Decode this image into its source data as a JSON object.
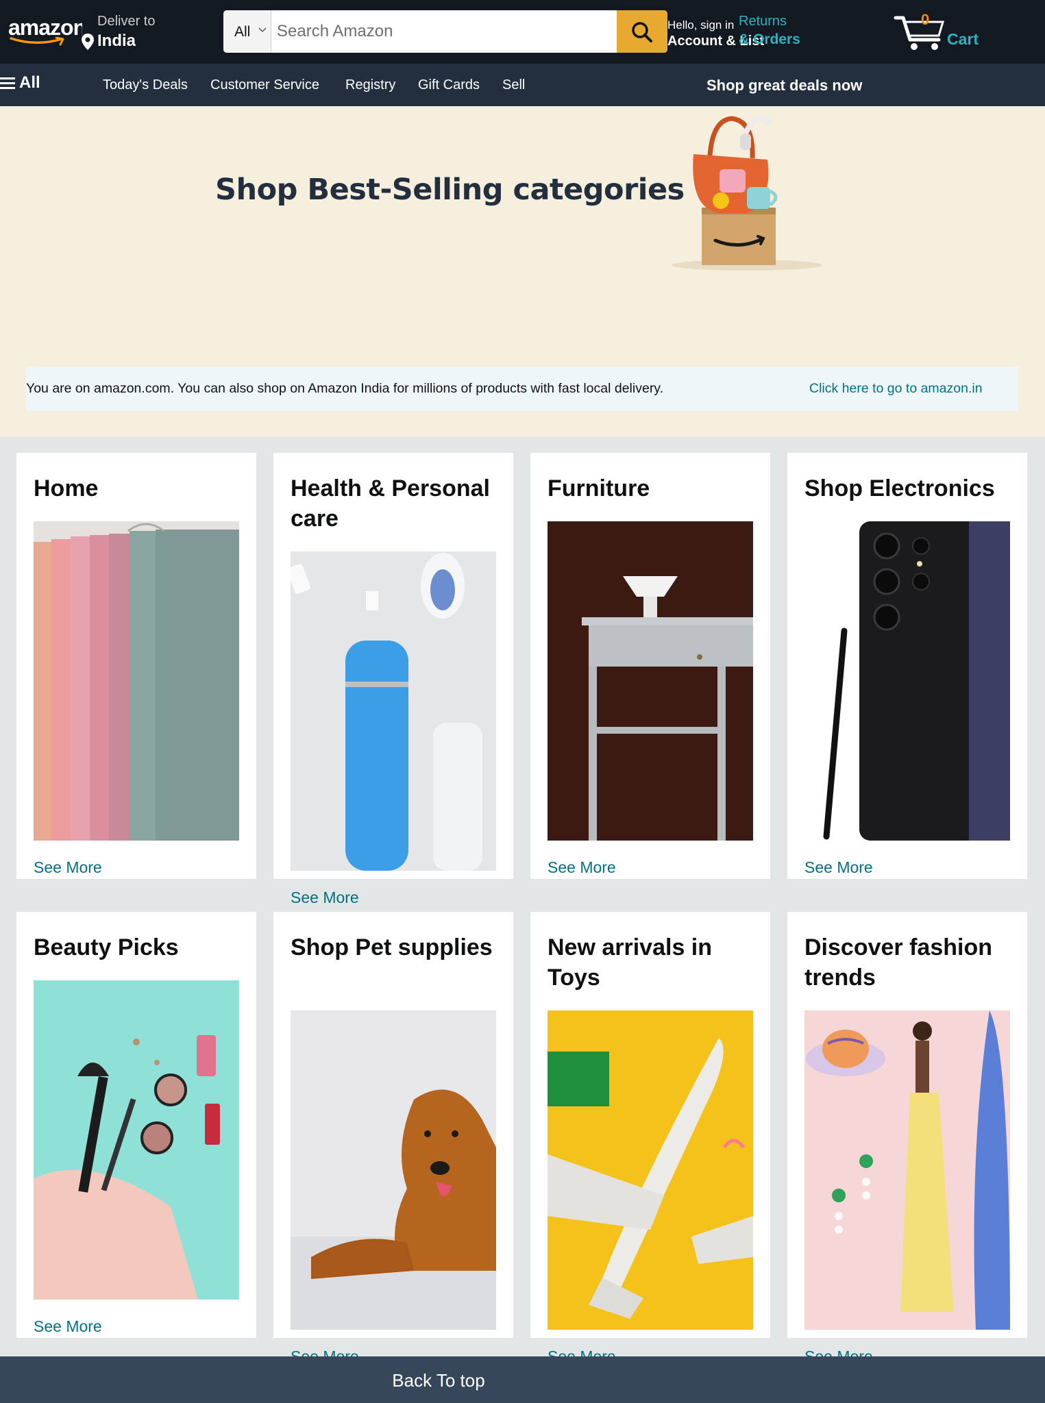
{
  "header": {
    "logo_text": "amazon",
    "deliver_label": "Deliver to",
    "deliver_location": "India",
    "search": {
      "category": "All",
      "placeholder": "Search Amazon"
    },
    "account_greeting": "Hello, sign in",
    "account_label": "Account & List",
    "returns_label": "Returns",
    "orders_label": "& Orders",
    "cart_count": "0",
    "cart_label": "Cart",
    "colors": {
      "bar": "#131921",
      "subnav": "#232f3e",
      "search_button": "#e7a930",
      "accent_link": "#2bb3bf",
      "cart_count": "#f08804"
    }
  },
  "subnav": {
    "all_label": "All",
    "items": [
      "Today's Deals",
      "Customer Service",
      "Registry",
      "Gift Cards",
      "Sell"
    ],
    "promo": "Shop great deals now"
  },
  "hero": {
    "title": "Shop Best-Selling categories",
    "notice_text": "You are on amazon.com. You can also shop on Amazon India for millions of products with fast local delivery.",
    "notice_link": "Click here to go to amazon.in"
  },
  "cards": [
    {
      "title": "Home",
      "link": "See More",
      "image": "folded-towels"
    },
    {
      "title": "Health & Personal care",
      "link": "See More",
      "image": "health-products"
    },
    {
      "title": "Furniture",
      "link": "See More",
      "image": "side-table"
    },
    {
      "title": "Shop Electronics",
      "link": "See More",
      "image": "smartphone"
    },
    {
      "title": "Beauty Picks",
      "link": "See More",
      "image": "makeup"
    },
    {
      "title": "Shop Pet supplies",
      "link": "See More",
      "image": "dog"
    },
    {
      "title": "New arrivals in Toys",
      "link": "See More",
      "image": "toy-airplane"
    },
    {
      "title": "Discover fashion trends",
      "link": "See More",
      "image": "fashion-model"
    }
  ],
  "footer": {
    "back_to_top": "Back To top"
  }
}
